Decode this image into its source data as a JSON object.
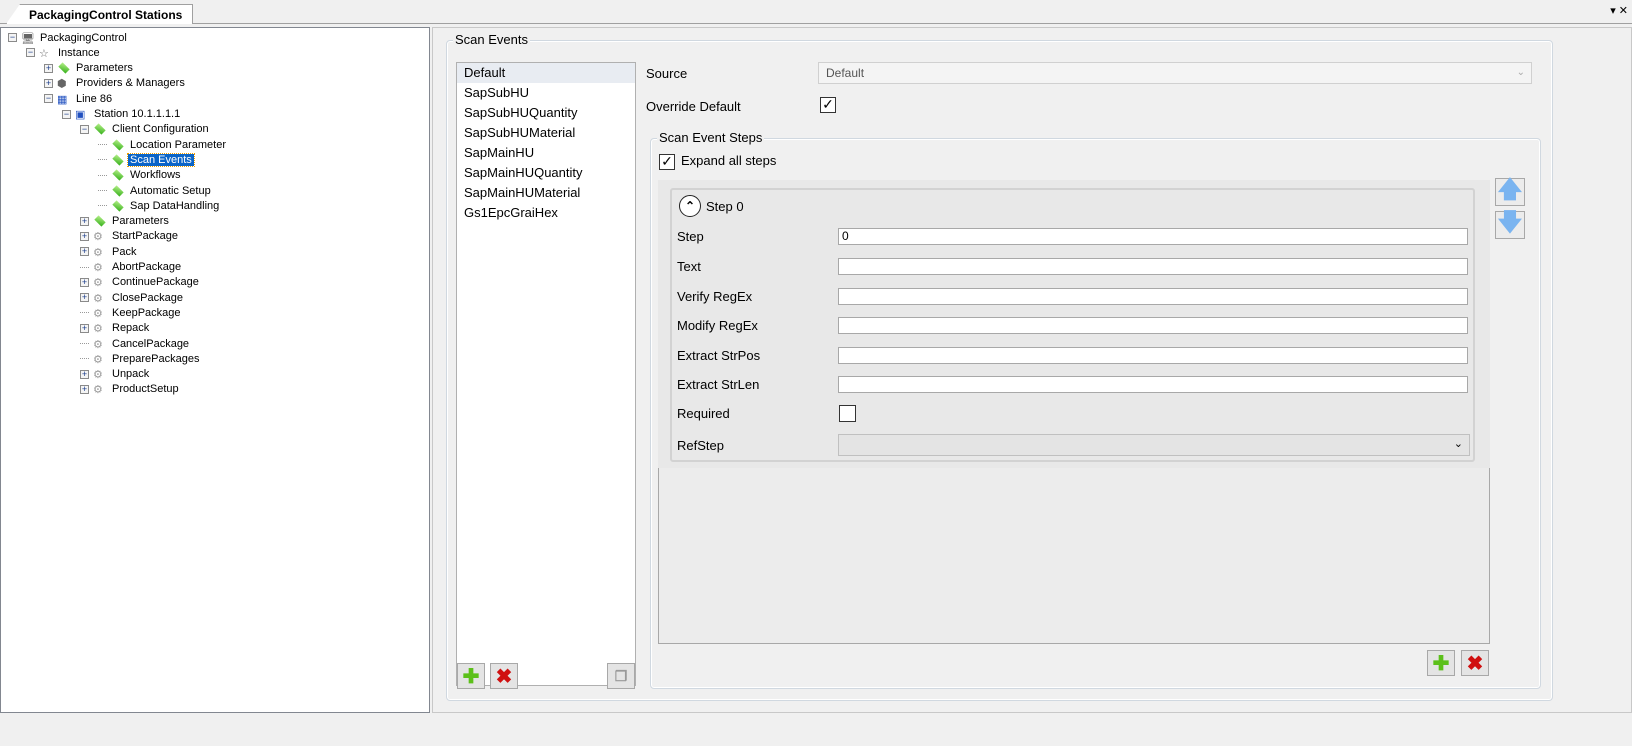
{
  "tab": {
    "title": "PackagingControl Stations",
    "controls": "▾ ✕"
  },
  "tree": [
    {
      "label": "PackagingControl",
      "depth": 0,
      "toggle": "-",
      "icon": "app"
    },
    {
      "label": "Instance",
      "depth": 1,
      "toggle": "-",
      "icon": "star"
    },
    {
      "label": "Parameters",
      "depth": 2,
      "toggle": "+",
      "icon": "diamond"
    },
    {
      "label": "Providers & Managers",
      "depth": 2,
      "toggle": "+",
      "icon": "cubes"
    },
    {
      "label": "Line 86",
      "depth": 2,
      "toggle": "-",
      "icon": "network"
    },
    {
      "label": "Station 10.1.1.1.1",
      "depth": 3,
      "toggle": "-",
      "icon": "monitor"
    },
    {
      "label": "Client Configuration",
      "depth": 4,
      "toggle": "-",
      "icon": "diamond"
    },
    {
      "label": "Location Parameter",
      "depth": 5,
      "toggle": "",
      "icon": "diamond"
    },
    {
      "label": "Scan Events",
      "depth": 5,
      "toggle": "",
      "icon": "diamond",
      "selected": true
    },
    {
      "label": "Workflows",
      "depth": 5,
      "toggle": "",
      "icon": "diamond"
    },
    {
      "label": "Automatic Setup",
      "depth": 5,
      "toggle": "",
      "icon": "diamond"
    },
    {
      "label": "Sap DataHandling",
      "depth": 5,
      "toggle": "",
      "icon": "diamond"
    },
    {
      "label": "Parameters",
      "depth": 4,
      "toggle": "+",
      "icon": "diamond"
    },
    {
      "label": "StartPackage",
      "depth": 4,
      "toggle": "+",
      "icon": "gear"
    },
    {
      "label": "Pack",
      "depth": 4,
      "toggle": "+",
      "icon": "gear"
    },
    {
      "label": "AbortPackage",
      "depth": 4,
      "toggle": "",
      "icon": "gear"
    },
    {
      "label": "ContinuePackage",
      "depth": 4,
      "toggle": "+",
      "icon": "gear"
    },
    {
      "label": "ClosePackage",
      "depth": 4,
      "toggle": "+",
      "icon": "gear"
    },
    {
      "label": "KeepPackage",
      "depth": 4,
      "toggle": "",
      "icon": "gear"
    },
    {
      "label": "Repack",
      "depth": 4,
      "toggle": "+",
      "icon": "gear"
    },
    {
      "label": "CancelPackage",
      "depth": 4,
      "toggle": "",
      "icon": "gear"
    },
    {
      "label": "PreparePackages",
      "depth": 4,
      "toggle": "",
      "icon": "gear"
    },
    {
      "label": "Unpack",
      "depth": 4,
      "toggle": "+",
      "icon": "gear"
    },
    {
      "label": "ProductSetup",
      "depth": 4,
      "toggle": "+",
      "icon": "gear"
    }
  ],
  "scan_events": {
    "title": "Scan Events",
    "items": [
      "Default",
      "SapSubHU",
      "SapSubHUQuantity",
      "SapSubHUMaterial",
      "SapMainHU",
      "SapMainHUQuantity",
      "SapMainHUMaterial",
      "Gs1EpcGraiHex"
    ],
    "source_label": "Source",
    "source_value": "Default",
    "override_label": "Override Default",
    "override_checked": true
  },
  "steps": {
    "title": "Scan Event Steps",
    "expand_label": "Expand all steps",
    "expand_checked": true,
    "step_title": "Step 0",
    "fields": [
      {
        "label": "Step",
        "value": "0"
      },
      {
        "label": "Text",
        "value": ""
      },
      {
        "label": "Verify RegEx",
        "value": ""
      },
      {
        "label": "Modify RegEx",
        "value": ""
      },
      {
        "label": "Extract StrPos",
        "value": ""
      },
      {
        "label": "Extract StrLen",
        "value": ""
      }
    ],
    "required_label": "Required",
    "refstep_label": "RefStep"
  }
}
